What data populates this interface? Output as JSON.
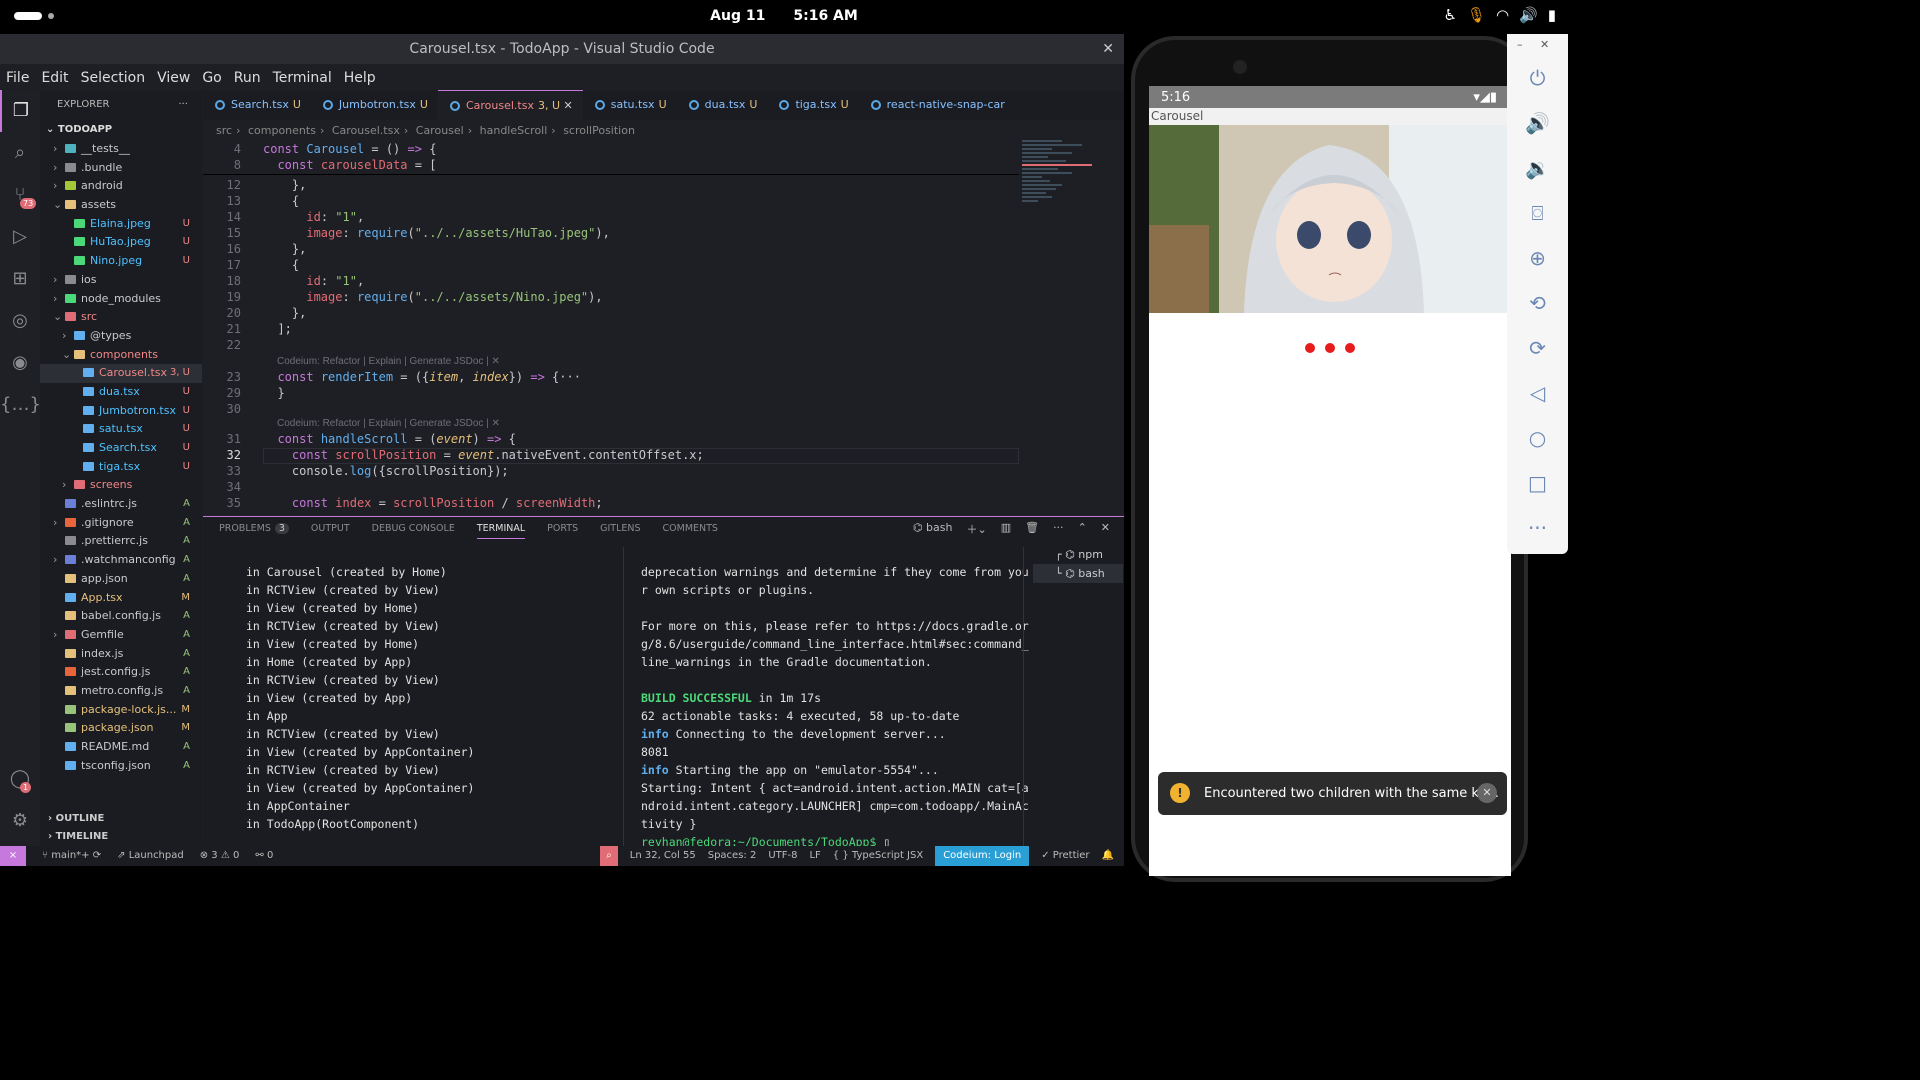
{
  "topbar": {
    "date": "Aug 11",
    "time": "5:16 AM"
  },
  "window": {
    "title": "Carousel.tsx - TodoApp - Visual Studio Code"
  },
  "menu": [
    "File",
    "Edit",
    "Selection",
    "View",
    "Go",
    "Run",
    "Terminal",
    "Help"
  ],
  "activity": {
    "scm_badge": "73",
    "accounts_badge": "1"
  },
  "explorer": {
    "header": "EXPLORER",
    "root": "TODOAPP",
    "items": [
      {
        "name": "__tests__",
        "status": "",
        "color": "#4fb3bf",
        "depth": 1
      },
      {
        "name": ".bundle",
        "status": "",
        "color": "#8a8a90",
        "depth": 1
      },
      {
        "name": "android",
        "status": "",
        "color": "#a4c639",
        "depth": 1
      },
      {
        "name": "assets",
        "status": "",
        "color": "#e5c07b",
        "depth": 1
      },
      {
        "name": "Elaina.jpeg",
        "status": "U",
        "color": "#4bd879",
        "depth": 2
      },
      {
        "name": "HuTao.jpeg",
        "status": "U",
        "color": "#4bd879",
        "depth": 2
      },
      {
        "name": "Nino.jpeg",
        "status": "U",
        "color": "#4bd879",
        "depth": 2
      },
      {
        "name": "ios",
        "status": "",
        "color": "#8a8a90",
        "depth": 1
      },
      {
        "name": "node_modules",
        "status": "",
        "color": "#4bd879",
        "depth": 1
      },
      {
        "name": "src",
        "status": "",
        "color": "#e06c75",
        "depth": 1
      },
      {
        "name": "@types",
        "status": "",
        "color": "#61afef",
        "depth": 2
      },
      {
        "name": "components",
        "status": "",
        "color": "#e5c07b",
        "depth": 2
      },
      {
        "name": "Carousel.tsx",
        "status": "3, U",
        "color": "#61afef",
        "depth": 3
      },
      {
        "name": "dua.tsx",
        "status": "U",
        "color": "#61afef",
        "depth": 3
      },
      {
        "name": "Jumbotron.tsx",
        "status": "U",
        "color": "#61afef",
        "depth": 3
      },
      {
        "name": "satu.tsx",
        "status": "U",
        "color": "#61afef",
        "depth": 3
      },
      {
        "name": "Search.tsx",
        "status": "U",
        "color": "#61afef",
        "depth": 3
      },
      {
        "name": "tiga.tsx",
        "status": "U",
        "color": "#61afef",
        "depth": 3
      },
      {
        "name": "screens",
        "status": "",
        "color": "#e06c75",
        "depth": 2
      },
      {
        "name": ".eslintrc.js",
        "status": "A",
        "color": "#6b7fd7",
        "depth": 1
      },
      {
        "name": ".gitignore",
        "status": "A",
        "color": "#e8643a",
        "depth": 1
      },
      {
        "name": ".prettierrc.js",
        "status": "A",
        "color": "#8a8a90",
        "depth": 1
      },
      {
        "name": ".watchmanconfig",
        "status": "A",
        "color": "#6b7fd7",
        "depth": 1
      },
      {
        "name": "app.json",
        "status": "A",
        "color": "#e5c07b",
        "depth": 1
      },
      {
        "name": "App.tsx",
        "status": "M",
        "color": "#61afef",
        "depth": 1
      },
      {
        "name": "babel.config.js",
        "status": "A",
        "color": "#e5c07b",
        "depth": 1
      },
      {
        "name": "Gemfile",
        "status": "A",
        "color": "#e06c75",
        "depth": 1
      },
      {
        "name": "index.js",
        "status": "A",
        "color": "#e5c07b",
        "depth": 1
      },
      {
        "name": "jest.config.js",
        "status": "A",
        "color": "#e8643a",
        "depth": 1
      },
      {
        "name": "metro.config.js",
        "status": "A",
        "color": "#e5c07b",
        "depth": 1
      },
      {
        "name": "package-lock.js...",
        "status": "M",
        "color": "#98c379",
        "depth": 1
      },
      {
        "name": "package.json",
        "status": "M",
        "color": "#98c379",
        "depth": 1
      },
      {
        "name": "README.md",
        "status": "A",
        "color": "#61afef",
        "depth": 1
      },
      {
        "name": "tsconfig.json",
        "status": "A",
        "color": "#61afef",
        "depth": 1
      }
    ],
    "outline": "OUTLINE",
    "timeline": "TIMELINE"
  },
  "tabs": [
    {
      "label": "Search.tsx",
      "status": "U"
    },
    {
      "label": "Jumbotron.tsx",
      "status": "U"
    },
    {
      "label": "Carousel.tsx",
      "status": "3, U",
      "active": true
    },
    {
      "label": "satu.tsx",
      "status": "U"
    },
    {
      "label": "dua.tsx",
      "status": "U"
    },
    {
      "label": "tiga.tsx",
      "status": "U"
    },
    {
      "label": "react-native-snap-car",
      "status": ""
    }
  ],
  "breadcrumbs": [
    "src",
    "components",
    "Carousel.tsx",
    "Carousel",
    "handleScroll",
    "scrollPosition"
  ],
  "codelens": "Codeium: Refactor | Explain | Generate JSDoc | ✕",
  "panel": {
    "tabs": [
      "PROBLEMS",
      "OUTPUT",
      "DEBUG CONSOLE",
      "TERMINAL",
      "PORTS",
      "GITLENS",
      "COMMENTS"
    ],
    "problems_count": "3",
    "shell": "bash",
    "term_left": [
      "in Carousel (created by Home)",
      "in RCTView (created by View)",
      "in View (created by Home)",
      "in RCTView (created by View)",
      "in View (created by Home)",
      "in Home (created by App)",
      "in RCTView (created by View)",
      "in View (created by App)",
      "in App",
      "in RCTView (created by View)",
      "in View (created by AppContainer)",
      "in RCTView (created by View)",
      "in View (created by AppContainer)",
      "in AppContainer",
      "in TodoApp(RootComponent)"
    ],
    "term_right_1": "deprecation warnings and determine if they come from you\nr own scripts or plugins.\n\nFor more on this, please refer to https://docs.gradle.or\ng/8.6/userguide/command_line_interface.html#sec:command_\nline_warnings in the Gradle documentation.\n",
    "build": "BUILD SUCCESSFUL",
    "build_time": " in 1m 17s",
    "tasks": "62 actionable tasks: 4 executed, 58 up-to-date",
    "info1": "Connecting to the development server...",
    "port": "8081",
    "info2": "Starting the app on \"emulator-5554\"...",
    "intent": "Starting: Intent { act=android.intent.action.MAIN cat=[a\nndroid.intent.category.LAUNCHER] cmp=com.todoapp/.MainAc\ntivity }",
    "prompt": "reyhan@fedora:~/Documents/TodoApp$",
    "terminals": [
      "npm",
      "bash"
    ]
  },
  "status": {
    "branch": "main*+",
    "launchpad": "Launchpad",
    "errors": "3",
    "warnings": "0",
    "ports": "0",
    "position": "Ln 32, Col 55",
    "spaces": "Spaces: 2",
    "encoding": "UTF-8",
    "eol": "LF",
    "language": "TypeScript JSX",
    "codeium": "Codeium: Login",
    "prettier": "Prettier"
  },
  "phone": {
    "time": "5:16",
    "app_title": "Carousel",
    "toast": "Encountered two children with the same ke..."
  }
}
